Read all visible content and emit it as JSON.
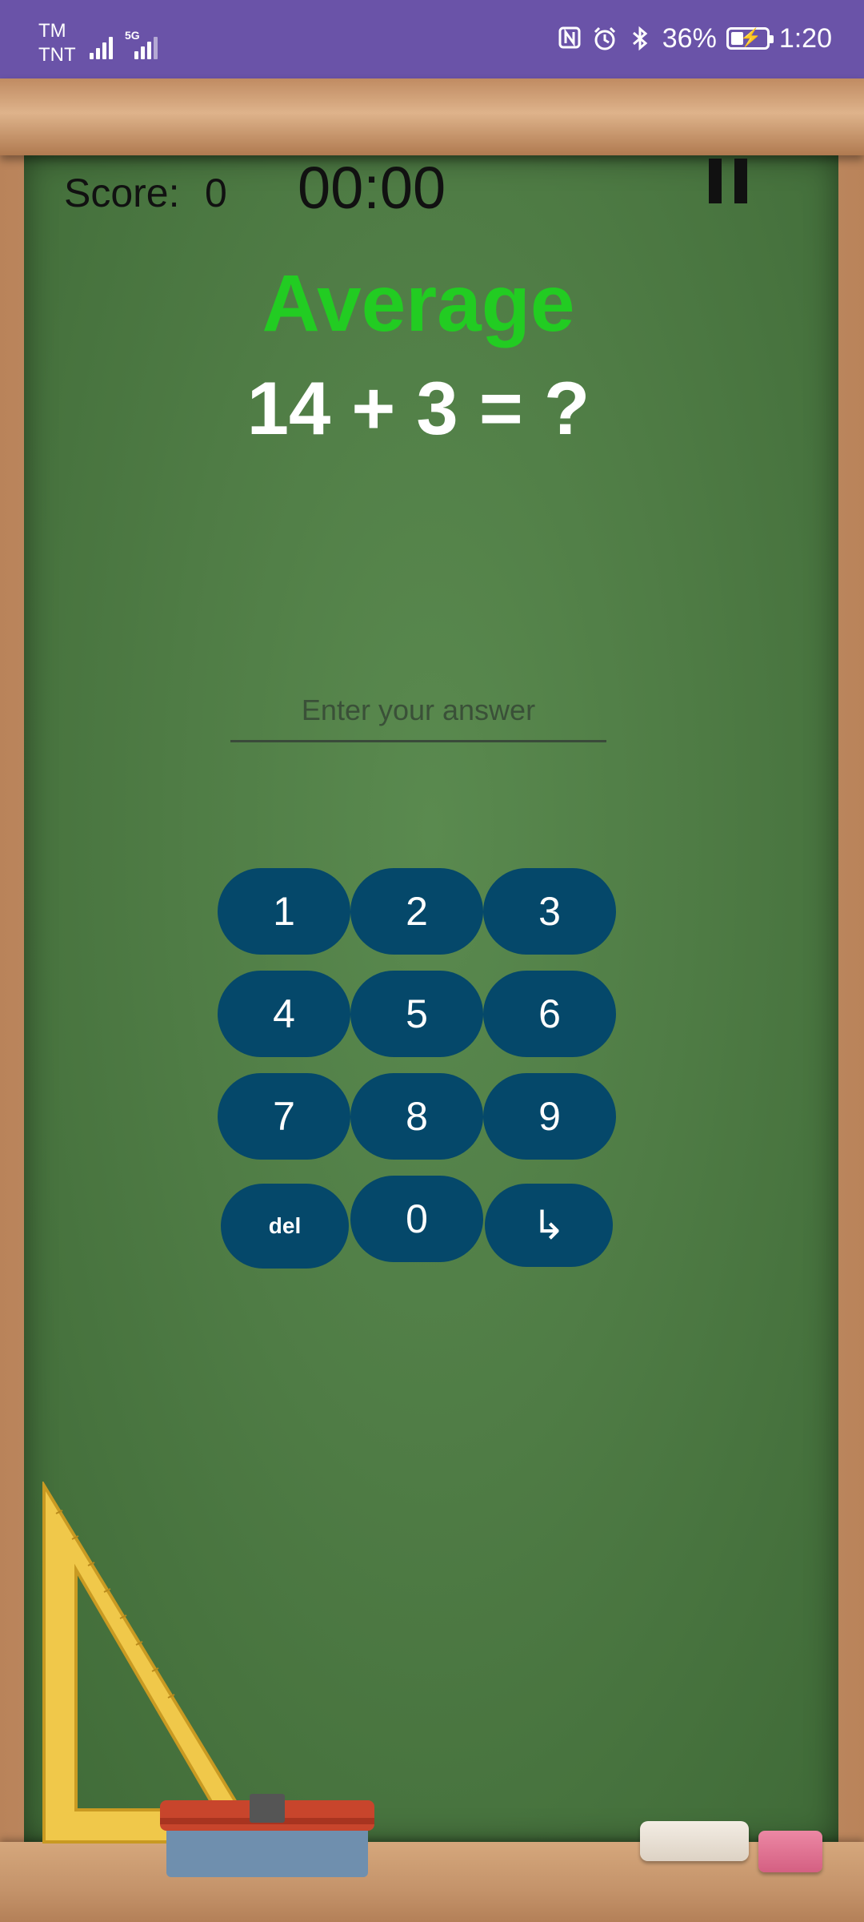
{
  "status_bar": {
    "carrier_1": "TM",
    "carrier_2": "TNT",
    "network_tag": "5G",
    "battery_percent": "36%",
    "battery_level": 0.36,
    "time": "1:20",
    "icons": [
      "signal-icon",
      "signal-5g-icon",
      "nfc-icon",
      "alarm-icon",
      "bluetooth-icon",
      "battery-charging-icon"
    ]
  },
  "game": {
    "score_label": "Score:",
    "score_value": "0",
    "timer": "00:00",
    "difficulty": "Average",
    "question": "14 + 3 = ?",
    "answer_placeholder": "Enter your answer",
    "answer_value": ""
  },
  "keypad": {
    "k1": "1",
    "k2": "2",
    "k3": "3",
    "k4": "4",
    "k5": "5",
    "k6": "6",
    "k7": "7",
    "k8": "8",
    "k9": "9",
    "del": "del",
    "k0": "0",
    "enter": "↳"
  },
  "colors": {
    "status_bar": "#6a53a8",
    "board": "#4f7c45",
    "difficulty": "#22cc22",
    "keypad_button": "#05486a",
    "frame": "#c8976b"
  }
}
